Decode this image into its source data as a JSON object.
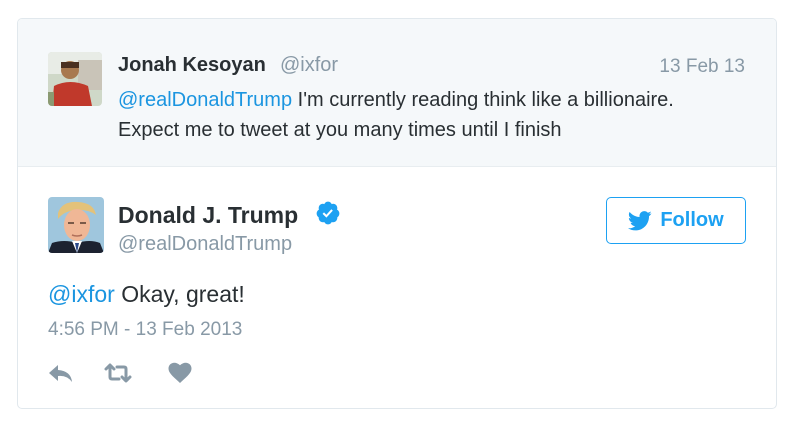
{
  "parent_tweet": {
    "author_name": "Jonah Kesoyan",
    "author_handle": "@ixfor",
    "date": "13 Feb 13",
    "mention": "@realDonaldTrump",
    "text_line1": " I'm currently reading think like a billionaire.",
    "text_line2": "Expect me to tweet at you many times until I finish"
  },
  "tweet": {
    "author_name": "Donald J. Trump",
    "author_handle": "@realDonaldTrump",
    "verified": true,
    "mention": "@ixfor",
    "text": " Okay, great!",
    "timestamp": "4:56 PM - 13 Feb 2013"
  },
  "follow_button": {
    "label": "Follow"
  },
  "actions": [
    {
      "icon": "reply-icon"
    },
    {
      "icon": "retweet-icon"
    },
    {
      "icon": "like-heart-icon"
    }
  ],
  "colors": {
    "accent": "#1da1f2",
    "link": "#1b95e0",
    "muted_text": "#8899a6",
    "parent_background": "#f5f8fa"
  }
}
